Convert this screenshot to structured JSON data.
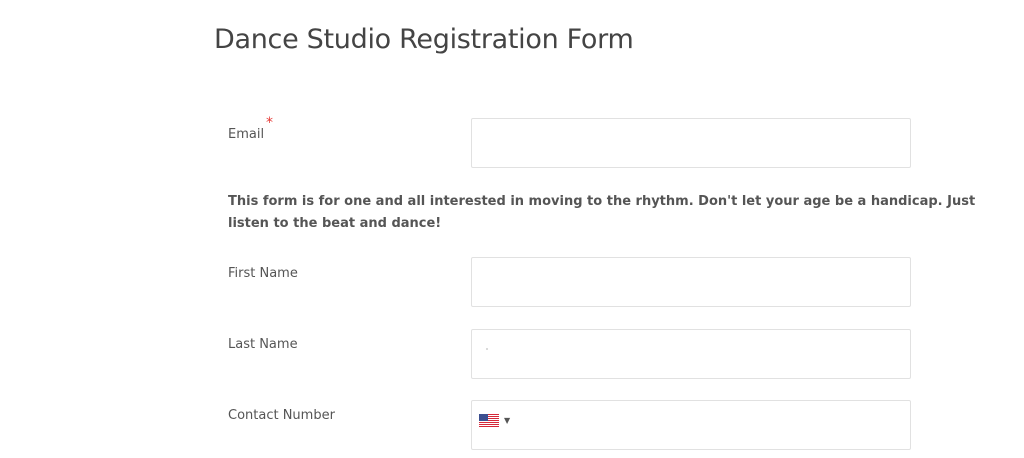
{
  "form": {
    "title": "Dance Studio Registration Form",
    "description": "This form is for one and all interested in moving to the rhythm. Don't let your age be a handicap. Just listen to the beat and dance!",
    "fields": {
      "email": {
        "label": "Email",
        "required_marker": "*",
        "value": ""
      },
      "first_name": {
        "label": "First Name",
        "value": ""
      },
      "last_name": {
        "label": "Last Name",
        "value": ""
      },
      "contact_number": {
        "label": "Contact Number",
        "value": "",
        "country_flag": "us-flag-icon"
      }
    }
  },
  "colors": {
    "required": "#e53935",
    "border": "#e1e1e1",
    "text": "#555555"
  }
}
